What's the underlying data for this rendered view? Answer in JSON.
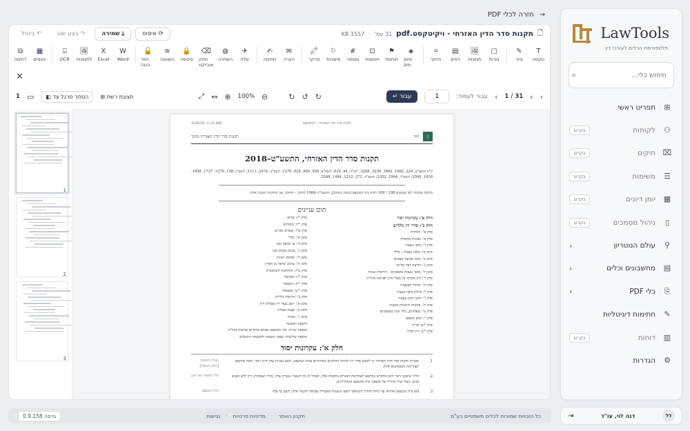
{
  "app": {
    "name": "LawTools",
    "tagline": "פלטפורמת הכלים לעורכי דין"
  },
  "search": {
    "placeholder": "חיפוש כלי..."
  },
  "nav": {
    "items": [
      {
        "label": "תפריט ראשי",
        "badge": "",
        "icon": "grid-icon"
      },
      {
        "label": "לקוחות",
        "badge": "בקרוב",
        "icon": "users-icon"
      },
      {
        "label": "תיקים",
        "badge": "בקרוב",
        "icon": "briefcase-icon"
      },
      {
        "label": "משימות",
        "badge": "בקרוב",
        "icon": "list-icon"
      },
      {
        "label": "יומן דיונים",
        "badge": "בקרוב",
        "icon": "calendar-icon"
      },
      {
        "label": "ניהול מסמכים",
        "badge": "בקרוב",
        "icon": "file-icon"
      },
      {
        "label": "עולם הנוטריון",
        "badge": "",
        "icon": "stamp-icon"
      },
      {
        "label": "מחשבונים וכלים",
        "badge": "",
        "icon": "calculator-icon"
      },
      {
        "label": "כלי PDF",
        "badge": "",
        "icon": "pdf-icon"
      },
      {
        "label": "חתימות דיגיטליות",
        "badge": "",
        "icon": "signature-icon"
      },
      {
        "label": "דוחות",
        "badge": "בקרוב",
        "icon": "report-icon"
      },
      {
        "label": "הגדרות",
        "badge": "",
        "icon": "gear-icon"
      }
    ]
  },
  "user": {
    "name": "דנה לוי, עו\"ד",
    "initials": "דל"
  },
  "footer": {
    "copyright": "כל הזכויות שמורות לכלים משפטיים בע\"מ",
    "links": [
      "תקנון האתר",
      "מדיניות פרטיות",
      "נגישות"
    ],
    "version": "גרסה 0.9.158"
  },
  "back": {
    "label": "חזרה לכלי PDF"
  },
  "doc": {
    "filename": "תקנות סדר הדין האזרחי - ויקיטקסט.pdf",
    "pages": "31 עמ'",
    "size": "KB 1557"
  },
  "actions": {
    "reset": "איפוס",
    "save": "שמירה",
    "redo": "בצע שוב",
    "undo": "ביטול"
  },
  "tools": [
    "טקסט",
    "ציור",
    "צורות",
    "תמונות",
    "דפים",
    "חיתוך",
    "סימן מים",
    "חותמת",
    "חותמות",
    "מספור",
    "סימניות",
    "מרקר",
    "הערה",
    "חתימה",
    "שלח",
    "השחרה",
    "מחק אובייקט",
    "סיסמה",
    "השוואה",
    "הסר הגנה",
    "Word",
    "Excel",
    "לתמונות",
    "OCR",
    "טפסים",
    "דחיסה"
  ],
  "view": {
    "page_label": "עבור לעמוד:",
    "page_value": "1",
    "page_of": "1 / 31",
    "go": "עבור",
    "zoom": "100%",
    "grid_view": "תצוגת רשת",
    "hide_sidebar": "הסתר סרגל צד",
    "page_count": "1"
  },
  "thumbs": [
    "1",
    "2",
    "3"
  ],
  "page": {
    "date": "3/25/26, 1:13 AM",
    "header_title": "תקנות סדר הדין האזרחי – ויקיטקסט",
    "brand_logo": "ספר",
    "brand": "תקנות סדר הדין האזרחי מתוך",
    "title": "תקנות סדר הדין האזרחי, התשע\"ט–2018",
    "refs": "ק\"ת תשע\"ט, 224, 1482, 1862, 3258, 3296; תש\"ף, 44, 510; תשפ\"א, 906, 909, 928, 1270; תשפ\"ב, 2474, 3113; תשפ\"ג, 158, 1270, 1727, 1858, 1918, 2500; תשפ\"ד, 1904, 2352; תשפ\"ה, 372, 1212, 1484, 2548.",
    "intro": "בתוקף סמכותי לפי סעיפים 108 ו־109 לחוק בתי המשפט [נוסח משולב], התשמ\"ד–1984 (להלן – החוק), אני מתקינה תקנות אלה:",
    "toc_title": "תוכן עניינים",
    "toc_right": [
      "חלק א': עקרונות יסוד",
      "חלק ב': סדרי דין כלליים",
      "פרק א': הגדרות",
      "פרק ב': סמכות מקומית",
      "פרק ג': כתבי טענות",
      "סימן א': כתבי טענות – כללי",
      "סימן ב': כתב תביעה שבכתב",
      "סימן ג': הודעה לצד שלישי",
      "סימן ד': כתבי טענות ומסמכים – הוראות שונות",
      "פרק ד': דיון מקדמי בין בעלי הדין ופגישת מהו\"ת",
      "פרק ה': איחוד תובענות",
      "פרק ו': סילוק כתבי טענות",
      "פרק ז': תיקון כתב טענות",
      "פרק ח': בקשות ורשימת בקשות",
      "פרק ט': שאלונים, גילוי ועיון במסמכים",
      "פרק י': קדם־משפט",
      "פרק י\"א: הדיון",
      "פרק י\"ב: דיון מהיר"
    ],
    "toc_left": [
      "פרק י\"ג: עדים",
      "פרק י\"ד: מומחים",
      "פרק ט\"ו: סעדים זמניים",
      "סימן א': כללי",
      "סימן ב': צו מניעה זמני",
      "סימן ג': עיכוב נכסים זמני",
      "סימן ד': תפיסת ראיות",
      "סימן ה': עיכוב יציאה מן הארץ",
      "פרק ט\"ז: ההחלטה השיפוטית",
      "פרק י\"ז: הערעור",
      "פרק י\"ח: הוצאות",
      "פרק י\"ט: המצאות",
      "פרק כ': הוראות כלליות",
      "סימן א': ייצוג בעלי דין ופסלות דיון",
      "סימן ב': טענת פסלות",
      "סימן ג': שונות",
      "תוספת ראשונה",
      "תוספת שנייה: בתי המשפט שבהם מתקיים פגישות מהו\"ת",
      "תוספת שלישית: טפסי הוצאות להבטחת התשלום"
    ],
    "part_title": "חלק א': עקרונות יסוד",
    "articles": [
      {
        "num": "1.",
        "side": "מטרות התקנות [תיקון: תשפ\"ג]",
        "text": "מטרות תקנות סדר הדין האזרחי הן לקבוע סדרי דין לניהול ההליכים האזרחיים בבית המשפט, לשם עשיית צדק ודיון ראוי, וזאת בהתאם לעקרונות המפורטים להלן."
      },
      {
        "num": "2.",
        "side": "הליך שיפוטי ראוי והוגן",
        "text": "הליך שיפוטי ראוי והוגן מתקיים בהתאם לעקרונות המנויים בתקנות אלה, ובכלל זה בין השאר: עשיית צדק, ברור העובדות, דיון ללא משוא פנים, ניצול יעיל ומידתי של משאבי בית המשפט והמתדיינים."
      },
      {
        "num": "3.",
        "side": "ניהול המשפט",
        "text": "(א) בית המשפט אחראי על ניהול ההליך השיפוטי לשם הגשמת המטרות שביסוד תקנות אלה; לשם כך עליו"
      }
    ]
  }
}
